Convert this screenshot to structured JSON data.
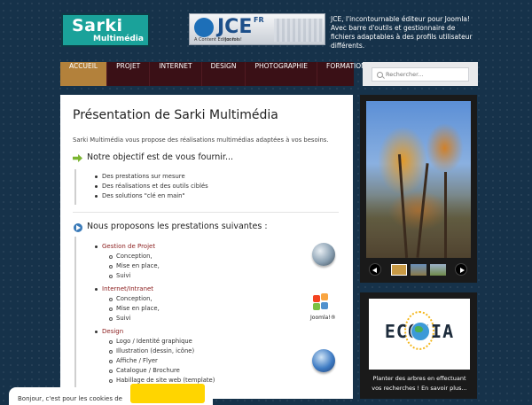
{
  "logo": {
    "line1": "Sarki",
    "line2": "Multimédia"
  },
  "jce_banner": {
    "brand": "JCE",
    "fr": "FR",
    "subtitle": "A Content Editor for",
    "joomla": "Joomla!"
  },
  "jce_text": "JCE, l'incontournable éditeur pour Joomla! Avec barre d'outils et gestionnaire de fichiers adaptables à des profils utilisateur différents.",
  "nav": {
    "items": [
      "ACCUEIL",
      "PROJET",
      "INTERNET",
      "DESIGN",
      "PHOTOGRAPHIE",
      "FORMATION"
    ],
    "active": "ACCUEIL"
  },
  "search": {
    "placeholder": "Rechercher..."
  },
  "content": {
    "title": "Présentation de Sarki Multimédia",
    "intro": "Sarki Multimédia vous propose des réalisations multimédias adaptées à vos besoins.",
    "objective_heading": "Notre objectif est de vous fournir...",
    "objective_items": [
      "Des prestations sur mesure",
      "Des réalisations et des outils ciblés",
      "Des solutions \"clé en main\""
    ],
    "services_heading": "Nous proposons les prestations suivantes :",
    "services": [
      {
        "name": "Gestion de Projet",
        "items": [
          "Conception,",
          "Mise en place,",
          "Suivi"
        ]
      },
      {
        "name": "Internet/Intranet",
        "items": [
          "Conception,",
          "Mise en place,",
          "Suivi"
        ]
      },
      {
        "name": "Design",
        "items": [
          "Logo / Identité graphique",
          "Illustration (dessin, icône)",
          "Affiche / Flyer",
          "Catalogue / Brochure",
          "Habillage de site web (template)"
        ]
      }
    ],
    "joomla_label": "Joomla!®"
  },
  "sidebar": {
    "ecosia_logo": "ECOSIA",
    "ecosia_text": "Planter des arbres en effectuant vos recherches ! En savoir plus..."
  },
  "cookie": {
    "text": "Bonjour, c'est pour les cookies de"
  },
  "colors": {
    "nav_bg": "#3a1016",
    "nav_active": "#b3813b",
    "accent_red": "#8b1d1d",
    "arrow_green": "#7bb531"
  }
}
